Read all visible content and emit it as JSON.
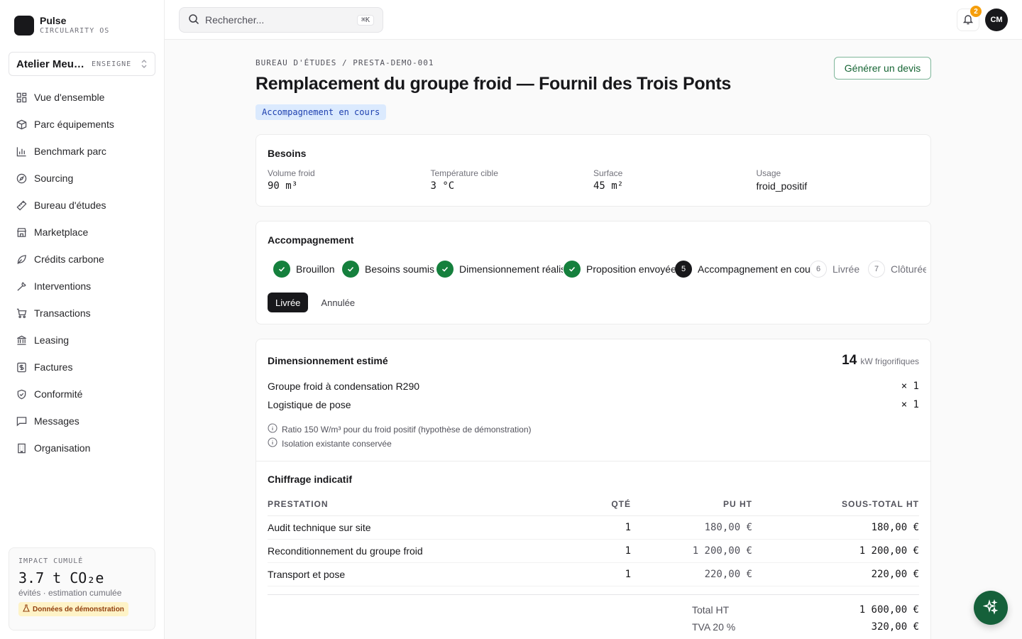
{
  "brand": {
    "name": "Pulse",
    "subtitle": "CIRCULARITY OS"
  },
  "org": {
    "name": "Atelier Meunier",
    "tag": "ENSEIGNE"
  },
  "nav": [
    {
      "label": "Vue d'ensemble",
      "icon": "grid-icon"
    },
    {
      "label": "Parc équipements",
      "icon": "box-icon"
    },
    {
      "label": "Benchmark parc",
      "icon": "bar-chart-icon"
    },
    {
      "label": "Sourcing",
      "icon": "compass-icon"
    },
    {
      "label": "Bureau d'études",
      "icon": "ruler-icon"
    },
    {
      "label": "Marketplace",
      "icon": "store-icon"
    },
    {
      "label": "Crédits carbone",
      "icon": "leaf-icon"
    },
    {
      "label": "Interventions",
      "icon": "wrench-icon"
    },
    {
      "label": "Transactions",
      "icon": "cart-icon"
    },
    {
      "label": "Leasing",
      "icon": "bank-icon"
    },
    {
      "label": "Factures",
      "icon": "invoice-icon"
    },
    {
      "label": "Conformité",
      "icon": "shield-icon"
    },
    {
      "label": "Messages",
      "icon": "message-icon"
    },
    {
      "label": "Organisation",
      "icon": "building-icon"
    }
  ],
  "impact": {
    "label": "IMPACT CUMULÉ",
    "value": "3.7 t CO₂e",
    "subtitle": "évités · estimation cumulée",
    "badge": "Données de démonstration"
  },
  "topbar": {
    "search_placeholder": "Rechercher...",
    "shortcut": "⌘K",
    "notification_count": "2",
    "avatar_initials": "CM"
  },
  "page": {
    "breadcrumb": "BUREAU D'ÉTUDES / PRESTA-DEMO-001",
    "title": "Remplacement du groupe froid — Fournil des Trois Ponts",
    "status": "Accompagnement en cours",
    "devis_button": "Générer un devis"
  },
  "besoins": {
    "title": "Besoins",
    "fields": [
      {
        "label": "Volume froid",
        "value": "90 m³"
      },
      {
        "label": "Température cible",
        "value": "3 °C"
      },
      {
        "label": "Surface",
        "value": "45 m²"
      },
      {
        "label": "Usage",
        "value": "froid_positif"
      }
    ]
  },
  "accompagnement": {
    "title": "Accompagnement",
    "steps": [
      {
        "num": "1",
        "label": "Brouillon",
        "state": "done"
      },
      {
        "num": "2",
        "label": "Besoins soumis",
        "state": "done"
      },
      {
        "num": "3",
        "label": "Dimensionnement réalisé",
        "state": "done"
      },
      {
        "num": "4",
        "label": "Proposition envoyée",
        "state": "done"
      },
      {
        "num": "5",
        "label": "Accompagnement en cours",
        "state": "current"
      },
      {
        "num": "6",
        "label": "Livrée",
        "state": "todo"
      },
      {
        "num": "7",
        "label": "Clôturée",
        "state": "todo"
      }
    ],
    "primary_action": "Livrée",
    "secondary_action": "Annulée"
  },
  "dimensionnement": {
    "title": "Dimensionnement estimé",
    "kw_value": "14",
    "kw_unit": "kW frigorifiques",
    "lines": [
      {
        "label": "Groupe froid à condensation R290",
        "qty": "× 1"
      },
      {
        "label": "Logistique de pose",
        "qty": "× 1"
      }
    ],
    "notes": [
      "Ratio 150 W/m³ pour du froid positif (hypothèse de démonstration)",
      "Isolation existante conservée"
    ]
  },
  "chiffrage": {
    "title": "Chiffrage indicatif",
    "headers": {
      "prestation": "PRESTATION",
      "qte": "QTÉ",
      "pu": "PU HT",
      "sous_total": "SOUS-TOTAL HT"
    },
    "rows": [
      {
        "prestation": "Audit technique sur site",
        "qte": "1",
        "pu": "180,00 €",
        "sous_total": "180,00 €"
      },
      {
        "prestation": "Reconditionnement du groupe froid",
        "qte": "1",
        "pu": "1 200,00 €",
        "sous_total": "1 200,00 €"
      },
      {
        "prestation": "Transport et pose",
        "qte": "1",
        "pu": "220,00 €",
        "sous_total": "220,00 €"
      }
    ],
    "totals": [
      {
        "label": "Total HT",
        "value": "1 600,00 €"
      },
      {
        "label": "TVA 20 %",
        "value": "320,00 €"
      }
    ]
  },
  "colors": {
    "accent_green": "#15803d",
    "status_blue_bg": "#dbeafe",
    "badge_amber": "#f59e0b"
  }
}
